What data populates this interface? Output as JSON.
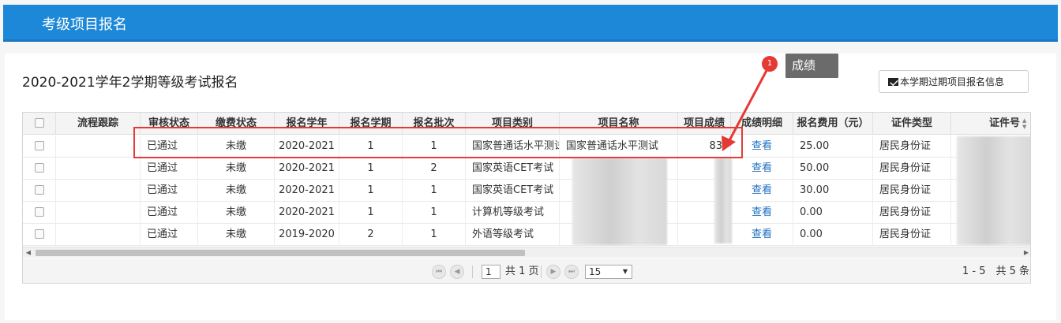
{
  "header": {
    "title": "考级项目报名"
  },
  "panel": {
    "title": "2020-2021学年2学期等级考试报名",
    "expired_button": "本学期过期项目报名信息"
  },
  "table": {
    "columns": [
      "流程跟踪",
      "审核状态",
      "缴费状态",
      "报名学年",
      "报名学期",
      "报名批次",
      "项目类别",
      "项目名称",
      "项目成绩",
      "成绩明细",
      "报名费用（元）",
      "证件类型",
      "证件号"
    ],
    "rows": [
      {
        "trace": "",
        "audit": "已通过",
        "pay": "未缴",
        "year": "2020-2021",
        "term": "1",
        "batch": "1",
        "category": "国家普通话水平测试",
        "name": "国家普通话水平测试",
        "score": "83",
        "detail": "查看",
        "fee": "25.00",
        "id_type": "居民身份证"
      },
      {
        "trace": "",
        "audit": "已通过",
        "pay": "未缴",
        "year": "2020-2021",
        "term": "1",
        "batch": "2",
        "category": "国家英语CET考试",
        "name": "",
        "score": "",
        "detail": "查看",
        "fee": "50.00",
        "id_type": "居民身份证"
      },
      {
        "trace": "",
        "audit": "已通过",
        "pay": "未缴",
        "year": "2020-2021",
        "term": "1",
        "batch": "1",
        "category": "国家英语CET考试",
        "name": "",
        "score": "",
        "detail": "查看",
        "fee": "30.00",
        "id_type": "居民身份证"
      },
      {
        "trace": "",
        "audit": "已通过",
        "pay": "未缴",
        "year": "2020-2021",
        "term": "1",
        "batch": "1",
        "category": "计算机等级考试",
        "name": "",
        "score": "",
        "detail": "查看",
        "fee": "0.00",
        "id_type": "居民身份证"
      },
      {
        "trace": "",
        "audit": "已通过",
        "pay": "未缴",
        "year": "2019-2020",
        "term": "2",
        "batch": "1",
        "category": "外语等级考试",
        "name": "",
        "score": "",
        "detail": "查看",
        "fee": "0.00",
        "id_type": "居民身份证"
      }
    ]
  },
  "pager": {
    "page_value": "1",
    "pages_text": "共 1 页",
    "page_size": "15",
    "summary": "1 - 5　共 5 条"
  },
  "annotation": {
    "badge": "1",
    "callout": "成绩"
  },
  "colors": {
    "header": "#1e88d8",
    "highlight": "#e53935",
    "link": "#1e6fc2"
  }
}
